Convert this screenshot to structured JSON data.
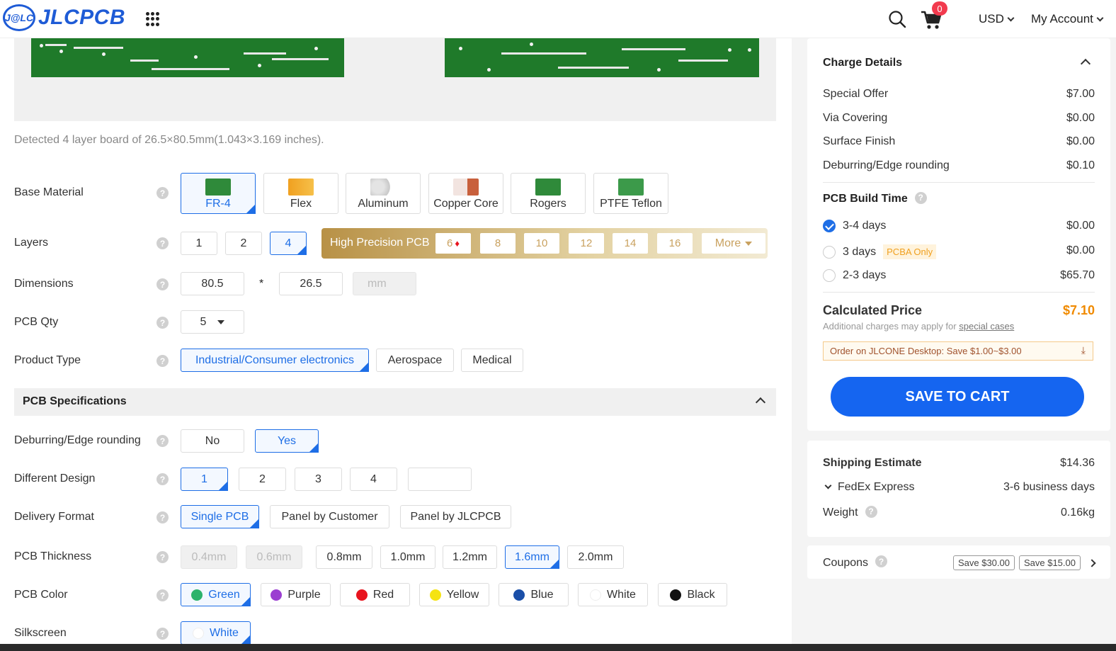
{
  "header": {
    "logo_badge": "J@LC",
    "logo_text": "JLCPCB",
    "cart_count": "0",
    "currency": "USD",
    "account": "My Account"
  },
  "detected_text": "Detected 4 layer board of 26.5×80.5mm(1.043×3.169 inches).",
  "labels": {
    "base_material": "Base Material",
    "layers": "Layers",
    "dimensions": "Dimensions",
    "pcb_qty": "PCB Qty",
    "product_type": "Product Type",
    "pcb_specs": "PCB Specifications",
    "deburring": "Deburring/Edge rounding",
    "different_design": "Different Design",
    "delivery_format": "Delivery Format",
    "pcb_thickness": "PCB Thickness",
    "pcb_color": "PCB Color",
    "silkscreen": "Silkscreen",
    "help": "?"
  },
  "base_material": [
    "FR-4",
    "Flex",
    "Aluminum",
    "Copper Core",
    "Rogers",
    "PTFE Teflon"
  ],
  "layers": {
    "basic": [
      "1",
      "2",
      "4"
    ],
    "high_precision_label": "High Precision PCB",
    "high_precision": [
      "6",
      "8",
      "10",
      "12",
      "14",
      "16"
    ],
    "more": "More"
  },
  "dimensions": {
    "length": "80.5",
    "times": "*",
    "width": "26.5",
    "unit": "mm"
  },
  "pcb_qty": "5",
  "product_type": [
    "Industrial/Consumer electronics",
    "Aerospace",
    "Medical"
  ],
  "deburring": [
    "No",
    "Yes"
  ],
  "different_design": [
    "1",
    "2",
    "3",
    "4",
    ""
  ],
  "delivery_format": [
    "Single PCB",
    "Panel by Customer",
    "Panel by JLCPCB"
  ],
  "pcb_thickness": [
    "0.4mm",
    "0.6mm",
    "0.8mm",
    "1.0mm",
    "1.2mm",
    "1.6mm",
    "2.0mm"
  ],
  "pcb_color": [
    {
      "label": "Green",
      "color": "#2db36b"
    },
    {
      "label": "Purple",
      "color": "#9b3fd1"
    },
    {
      "label": "Red",
      "color": "#e8141e"
    },
    {
      "label": "Yellow",
      "color": "#f5e312"
    },
    {
      "label": "Blue",
      "color": "#1a4fa8"
    },
    {
      "label": "White",
      "color": "#ffffff"
    },
    {
      "label": "Black",
      "color": "#111111"
    }
  ],
  "silkscreen": "White",
  "charge": {
    "title": "Charge Details",
    "items": [
      {
        "label": "Special Offer",
        "value": "$7.00"
      },
      {
        "label": "Via Covering",
        "value": "$0.00"
      },
      {
        "label": "Surface Finish",
        "value": "$0.00"
      },
      {
        "label": "Deburring/Edge rounding",
        "value": "$0.10"
      }
    ],
    "build_time_title": "PCB Build Time",
    "build_times": [
      {
        "label": "3-4 days",
        "value": "$0.00"
      },
      {
        "label": "3 days",
        "tag": "PCBA Only",
        "value": "$0.00"
      },
      {
        "label": "2-3 days",
        "value": "$65.70"
      }
    ],
    "calc_title": "Calculated Price",
    "calc_value": "$7.10",
    "calc_note": "Additional charges may apply for",
    "calc_link": "special cases",
    "jlcone": "Order on JLCONE Desktop: Save $1.00~$3.00",
    "save_button": "SAVE TO CART"
  },
  "shipping": {
    "title": "Shipping Estimate",
    "value": "$14.36",
    "carrier": "FedEx Express",
    "carrier_time": "3-6 business days",
    "weight_label": "Weight",
    "weight": "0.16kg"
  },
  "coupons": {
    "label": "Coupons",
    "tags": [
      "Save $30.00",
      "Save $15.00"
    ]
  },
  "colors": {
    "accent": "#1e6ee6",
    "cta": "#1565f0",
    "price": "#f08a00",
    "high_precision": "#b89146"
  }
}
